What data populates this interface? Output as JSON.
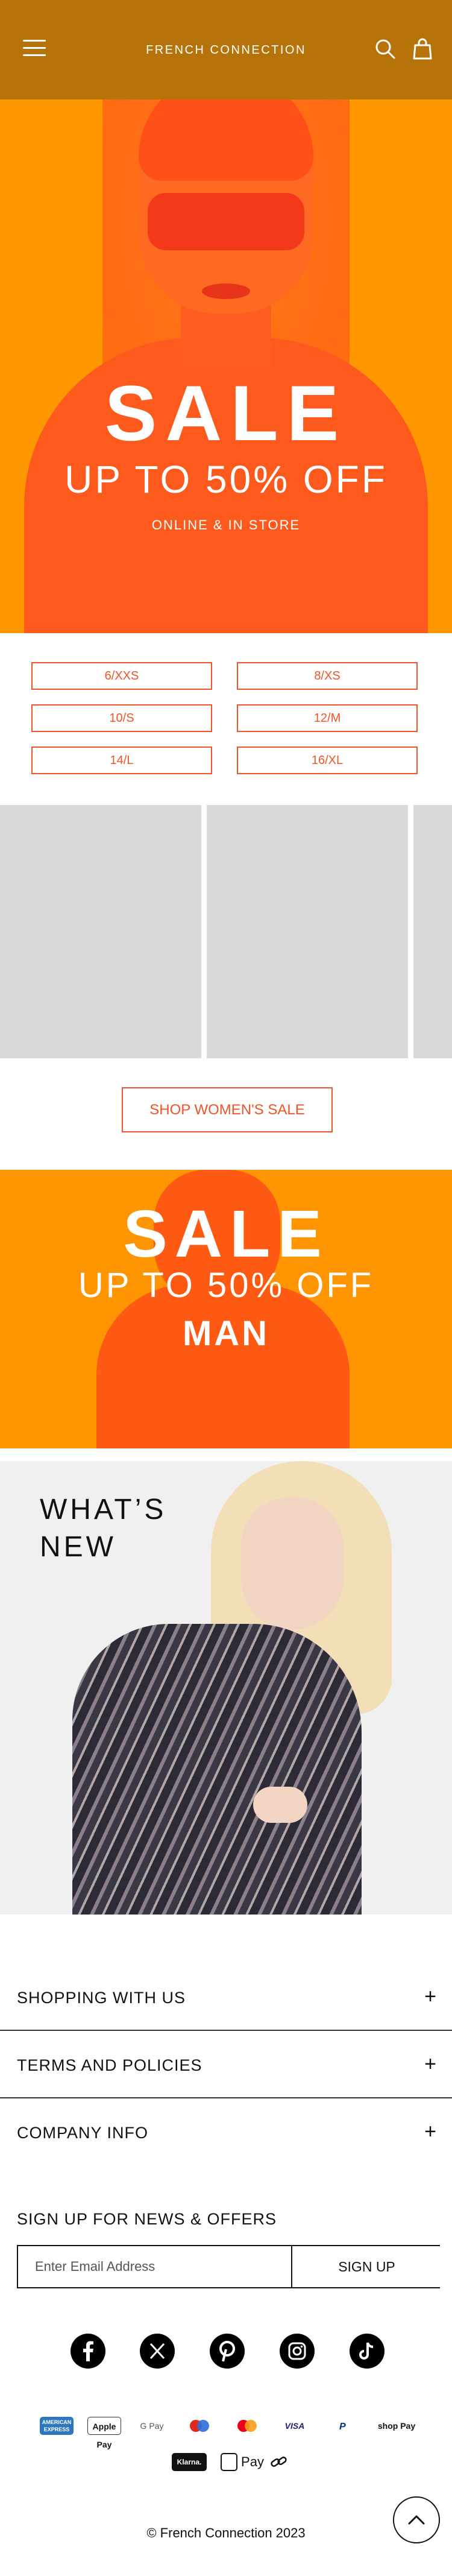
{
  "header": {
    "logo": "FRENCH CONNECTION",
    "menu_icon": "hamburger-menu-icon",
    "search_icon": "search-icon",
    "bag_icon": "shopping-bag-icon",
    "background": "#b5730a"
  },
  "hero_women": {
    "headline": "SALE",
    "subheadline": "UP TO 50% OFF",
    "tagline": "ONLINE & IN STORE",
    "accent": "#ff7a1a"
  },
  "sizes": [
    "6/XXS",
    "8/XS",
    "10/S",
    "12/M",
    "14/L",
    "16/XL"
  ],
  "shop_womens_sale": "SHOP WOMEN'S SALE",
  "hero_men": {
    "headline": "SALE",
    "subheadline": "UP TO 50% OFF",
    "label": "MAN"
  },
  "whats_new": {
    "title_line1": "WHAT’S",
    "title_line2": "NEW"
  },
  "footer": {
    "accordions": [
      "SHOPPING WITH US",
      "TERMS AND POLICIES",
      "COMPANY INFO"
    ],
    "newsletter": {
      "title": "SIGN UP FOR NEWS & OFFERS",
      "placeholder": "Enter Email Address",
      "button": "SIGN UP"
    },
    "social_icons": [
      "facebook-icon",
      "x-icon",
      "pinterest-icon",
      "instagram-icon",
      "tiktok-icon"
    ],
    "payment_methods": [
      "AMERICAN EXPRESS",
      "Apple Pay",
      "G Pay",
      "Maestro",
      "Mastercard",
      "VISA",
      "PayPal",
      "shop Pay",
      "Klarna.",
      "Pay",
      "link"
    ],
    "copyright": "© French Connection 2023"
  },
  "accent_color": "#f0542a"
}
